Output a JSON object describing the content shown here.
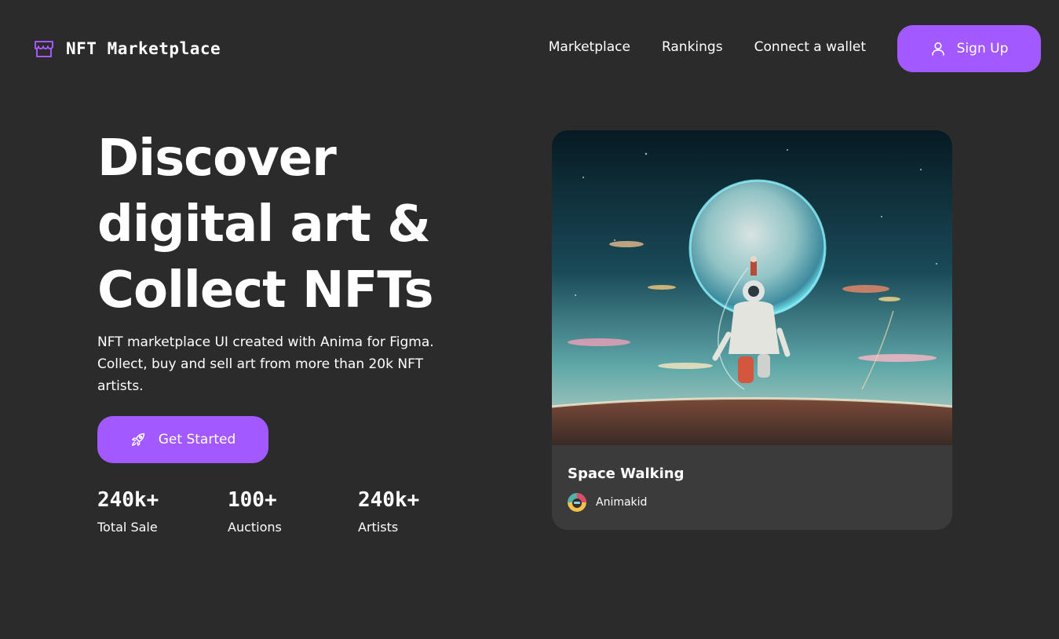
{
  "brand": {
    "name": "NFT Marketplace",
    "icon": "storefront-icon"
  },
  "nav": {
    "links": [
      "Marketplace",
      "Rankings",
      "Connect a wallet"
    ],
    "signup_label": "Sign Up",
    "signup_icon": "user-icon"
  },
  "hero": {
    "title_lines": [
      "Discover",
      "digital art &",
      "Collect NFTs"
    ],
    "description": "NFT marketplace UI created with Anima for Figma. Collect, buy and sell art from more than 20k NFT artists.",
    "cta_label": "Get Started",
    "cta_icon": "rocket-icon"
  },
  "stats": [
    {
      "value": "240k+",
      "label": "Total Sale"
    },
    {
      "value": "100+",
      "label": "Auctions"
    },
    {
      "value": "240k+",
      "label": "Artists"
    }
  ],
  "featured": {
    "title": "Space Walking",
    "artist": "Animakid",
    "image": "astronaut-planet-artwork"
  },
  "colors": {
    "background": "#2b2b2b",
    "accent": "#a259ff",
    "card": "#3b3b3b",
    "text": "#ffffff"
  }
}
